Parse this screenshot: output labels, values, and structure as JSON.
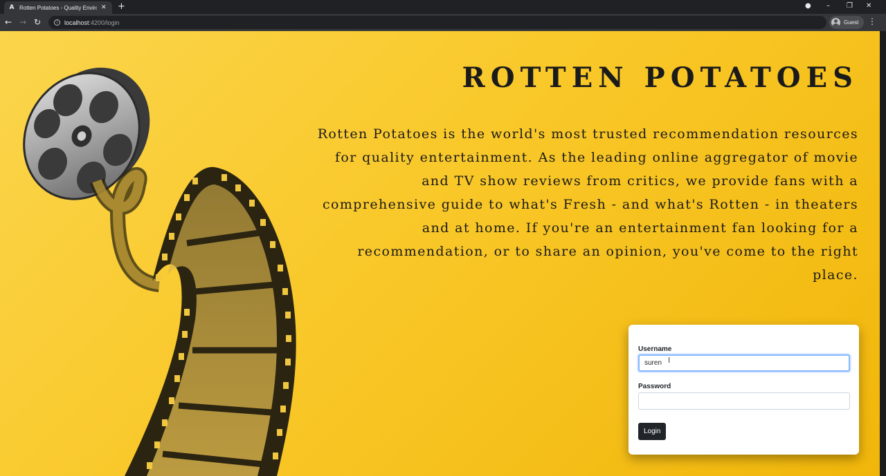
{
  "browser": {
    "tab_title": "Rotten Potatoes - Quality Enviro...",
    "tab_icon": "A",
    "url_host": "localhost",
    "url_path": ":4200/login",
    "profile_name": "Guest"
  },
  "page": {
    "brand_title": "ROTTEN POTATOES",
    "description": "Rotten Potatoes is the world's most trusted recommendation resources for quality entertainment. As the leading online aggregator of movie and TV show reviews from critics, we provide fans with a comprehensive guide to what's Fresh - and what's Rotten - in theaters and at home. If you're an entertainment fan looking for a recommendation, or to share an opinion, you've come to the right place."
  },
  "login_form": {
    "username_label": "Username",
    "username_value": "suren",
    "password_label": "Password",
    "password_value": "",
    "login_button": "Login"
  },
  "colors": {
    "page_background": "#f9c829",
    "text_dark": "#1a1a1a",
    "button_dark": "#212529"
  }
}
